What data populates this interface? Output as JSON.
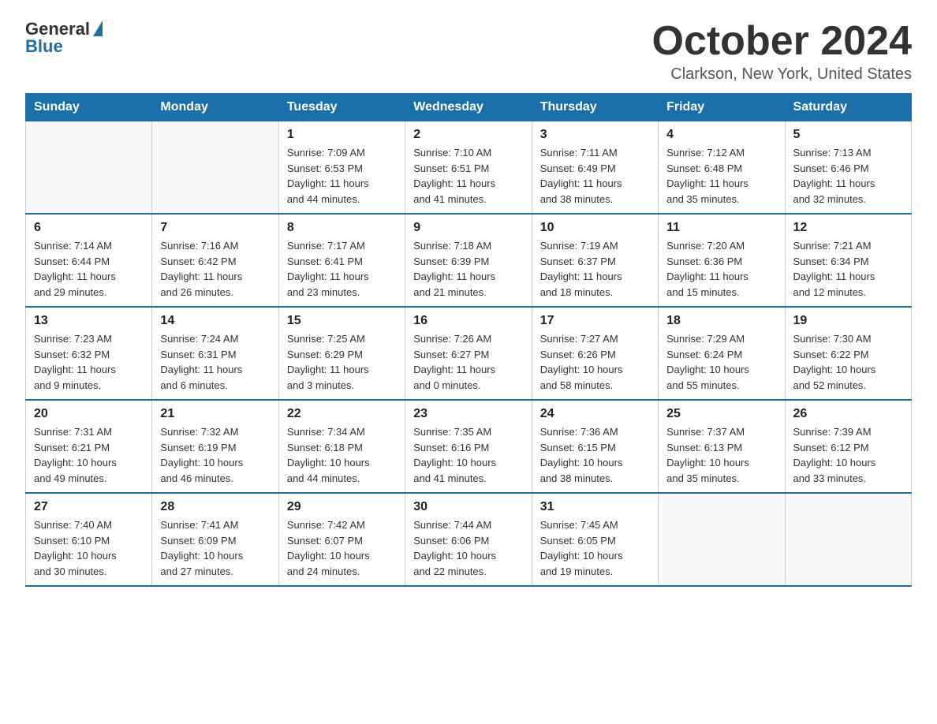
{
  "logo": {
    "general": "General",
    "blue": "Blue"
  },
  "header": {
    "month": "October 2024",
    "location": "Clarkson, New York, United States"
  },
  "weekdays": [
    "Sunday",
    "Monday",
    "Tuesday",
    "Wednesday",
    "Thursday",
    "Friday",
    "Saturday"
  ],
  "weeks": [
    [
      {
        "day": "",
        "info": ""
      },
      {
        "day": "",
        "info": ""
      },
      {
        "day": "1",
        "info": "Sunrise: 7:09 AM\nSunset: 6:53 PM\nDaylight: 11 hours\nand 44 minutes."
      },
      {
        "day": "2",
        "info": "Sunrise: 7:10 AM\nSunset: 6:51 PM\nDaylight: 11 hours\nand 41 minutes."
      },
      {
        "day": "3",
        "info": "Sunrise: 7:11 AM\nSunset: 6:49 PM\nDaylight: 11 hours\nand 38 minutes."
      },
      {
        "day": "4",
        "info": "Sunrise: 7:12 AM\nSunset: 6:48 PM\nDaylight: 11 hours\nand 35 minutes."
      },
      {
        "day": "5",
        "info": "Sunrise: 7:13 AM\nSunset: 6:46 PM\nDaylight: 11 hours\nand 32 minutes."
      }
    ],
    [
      {
        "day": "6",
        "info": "Sunrise: 7:14 AM\nSunset: 6:44 PM\nDaylight: 11 hours\nand 29 minutes."
      },
      {
        "day": "7",
        "info": "Sunrise: 7:16 AM\nSunset: 6:42 PM\nDaylight: 11 hours\nand 26 minutes."
      },
      {
        "day": "8",
        "info": "Sunrise: 7:17 AM\nSunset: 6:41 PM\nDaylight: 11 hours\nand 23 minutes."
      },
      {
        "day": "9",
        "info": "Sunrise: 7:18 AM\nSunset: 6:39 PM\nDaylight: 11 hours\nand 21 minutes."
      },
      {
        "day": "10",
        "info": "Sunrise: 7:19 AM\nSunset: 6:37 PM\nDaylight: 11 hours\nand 18 minutes."
      },
      {
        "day": "11",
        "info": "Sunrise: 7:20 AM\nSunset: 6:36 PM\nDaylight: 11 hours\nand 15 minutes."
      },
      {
        "day": "12",
        "info": "Sunrise: 7:21 AM\nSunset: 6:34 PM\nDaylight: 11 hours\nand 12 minutes."
      }
    ],
    [
      {
        "day": "13",
        "info": "Sunrise: 7:23 AM\nSunset: 6:32 PM\nDaylight: 11 hours\nand 9 minutes."
      },
      {
        "day": "14",
        "info": "Sunrise: 7:24 AM\nSunset: 6:31 PM\nDaylight: 11 hours\nand 6 minutes."
      },
      {
        "day": "15",
        "info": "Sunrise: 7:25 AM\nSunset: 6:29 PM\nDaylight: 11 hours\nand 3 minutes."
      },
      {
        "day": "16",
        "info": "Sunrise: 7:26 AM\nSunset: 6:27 PM\nDaylight: 11 hours\nand 0 minutes."
      },
      {
        "day": "17",
        "info": "Sunrise: 7:27 AM\nSunset: 6:26 PM\nDaylight: 10 hours\nand 58 minutes."
      },
      {
        "day": "18",
        "info": "Sunrise: 7:29 AM\nSunset: 6:24 PM\nDaylight: 10 hours\nand 55 minutes."
      },
      {
        "day": "19",
        "info": "Sunrise: 7:30 AM\nSunset: 6:22 PM\nDaylight: 10 hours\nand 52 minutes."
      }
    ],
    [
      {
        "day": "20",
        "info": "Sunrise: 7:31 AM\nSunset: 6:21 PM\nDaylight: 10 hours\nand 49 minutes."
      },
      {
        "day": "21",
        "info": "Sunrise: 7:32 AM\nSunset: 6:19 PM\nDaylight: 10 hours\nand 46 minutes."
      },
      {
        "day": "22",
        "info": "Sunrise: 7:34 AM\nSunset: 6:18 PM\nDaylight: 10 hours\nand 44 minutes."
      },
      {
        "day": "23",
        "info": "Sunrise: 7:35 AM\nSunset: 6:16 PM\nDaylight: 10 hours\nand 41 minutes."
      },
      {
        "day": "24",
        "info": "Sunrise: 7:36 AM\nSunset: 6:15 PM\nDaylight: 10 hours\nand 38 minutes."
      },
      {
        "day": "25",
        "info": "Sunrise: 7:37 AM\nSunset: 6:13 PM\nDaylight: 10 hours\nand 35 minutes."
      },
      {
        "day": "26",
        "info": "Sunrise: 7:39 AM\nSunset: 6:12 PM\nDaylight: 10 hours\nand 33 minutes."
      }
    ],
    [
      {
        "day": "27",
        "info": "Sunrise: 7:40 AM\nSunset: 6:10 PM\nDaylight: 10 hours\nand 30 minutes."
      },
      {
        "day": "28",
        "info": "Sunrise: 7:41 AM\nSunset: 6:09 PM\nDaylight: 10 hours\nand 27 minutes."
      },
      {
        "day": "29",
        "info": "Sunrise: 7:42 AM\nSunset: 6:07 PM\nDaylight: 10 hours\nand 24 minutes."
      },
      {
        "day": "30",
        "info": "Sunrise: 7:44 AM\nSunset: 6:06 PM\nDaylight: 10 hours\nand 22 minutes."
      },
      {
        "day": "31",
        "info": "Sunrise: 7:45 AM\nSunset: 6:05 PM\nDaylight: 10 hours\nand 19 minutes."
      },
      {
        "day": "",
        "info": ""
      },
      {
        "day": "",
        "info": ""
      }
    ]
  ]
}
